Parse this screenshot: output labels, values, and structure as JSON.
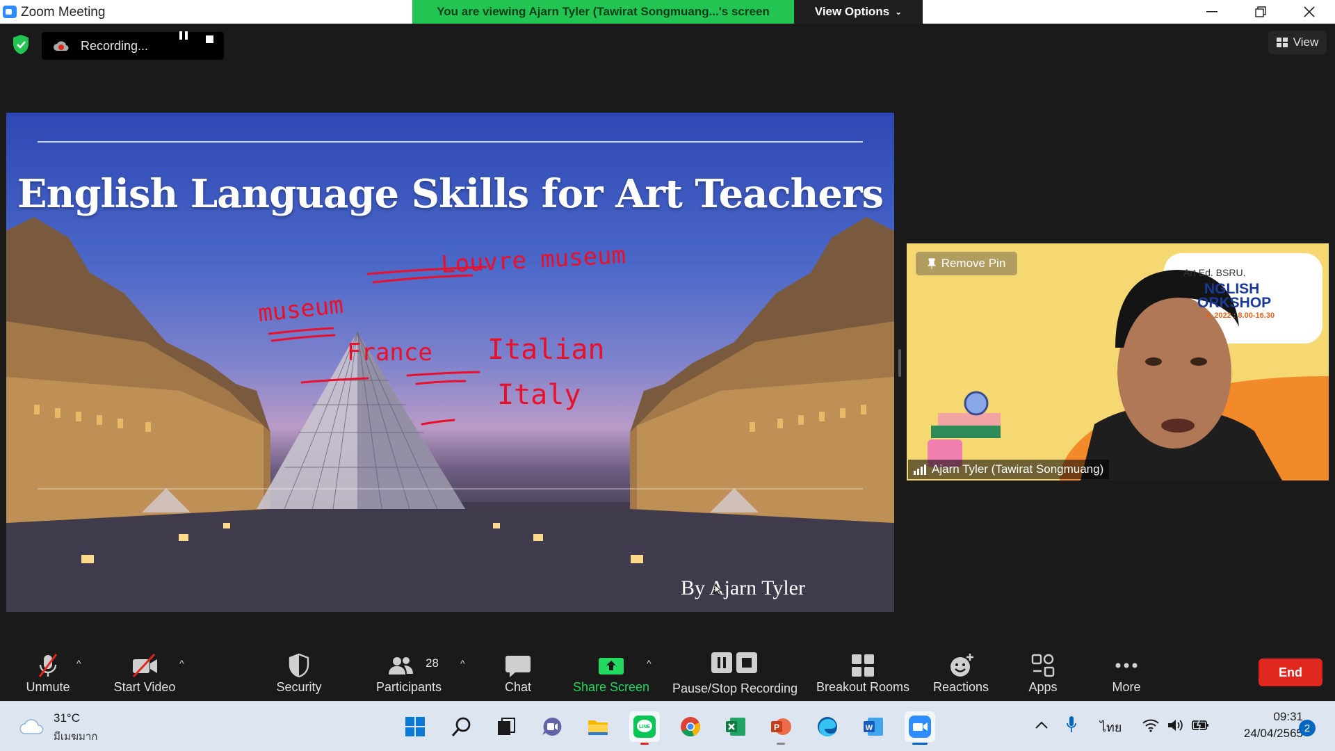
{
  "window": {
    "title": "Zoom Meeting",
    "share_banner": "You are viewing Ajarn Tyler (Tawirat Songmuang...'s screen",
    "view_options_label": "View Options"
  },
  "recording": {
    "status": "Recording..."
  },
  "view_button_label": "View",
  "slide": {
    "title": "English Language Skills for Art Teachers",
    "byline": "By Ajarn Tyler",
    "annotations": [
      "museum",
      "Louvre museum",
      "France",
      "Italian",
      "Italy"
    ]
  },
  "video": {
    "pin_label": "Remove Pin",
    "participant_name": "Ajarn Tyler (Tawirat Songmuang)",
    "background_text": [
      "Art Ed. BSRU.",
      "NGLISH",
      "ORKSHOP",
      "4, 2022 : 8.00-16.30"
    ]
  },
  "toolbar": {
    "unmute": "Unmute",
    "start_video": "Start Video",
    "security": "Security",
    "participants": "Participants",
    "participants_count": "28",
    "chat": "Chat",
    "share_screen": "Share Screen",
    "pause_stop_recording": "Pause/Stop Recording",
    "breakout_rooms": "Breakout Rooms",
    "reactions": "Reactions",
    "apps": "Apps",
    "more": "More",
    "end": "End"
  },
  "taskbar": {
    "weather_temp": "31°C",
    "weather_desc": "มีเมฆมาก",
    "language": "ไทย",
    "time": "09:31",
    "date": "24/04/2565",
    "notification_count": "2",
    "apps": [
      "start",
      "search",
      "task-view",
      "teams-chat",
      "file-explorer",
      "line",
      "chrome",
      "excel",
      "powerpoint",
      "edge",
      "word",
      "zoom"
    ]
  },
  "colors": {
    "banner_green": "#23c552",
    "share_green": "#23d95f",
    "end_red": "#e0281e",
    "zoom_blue": "#2d8cff",
    "annotation_red": "#e8102a"
  }
}
